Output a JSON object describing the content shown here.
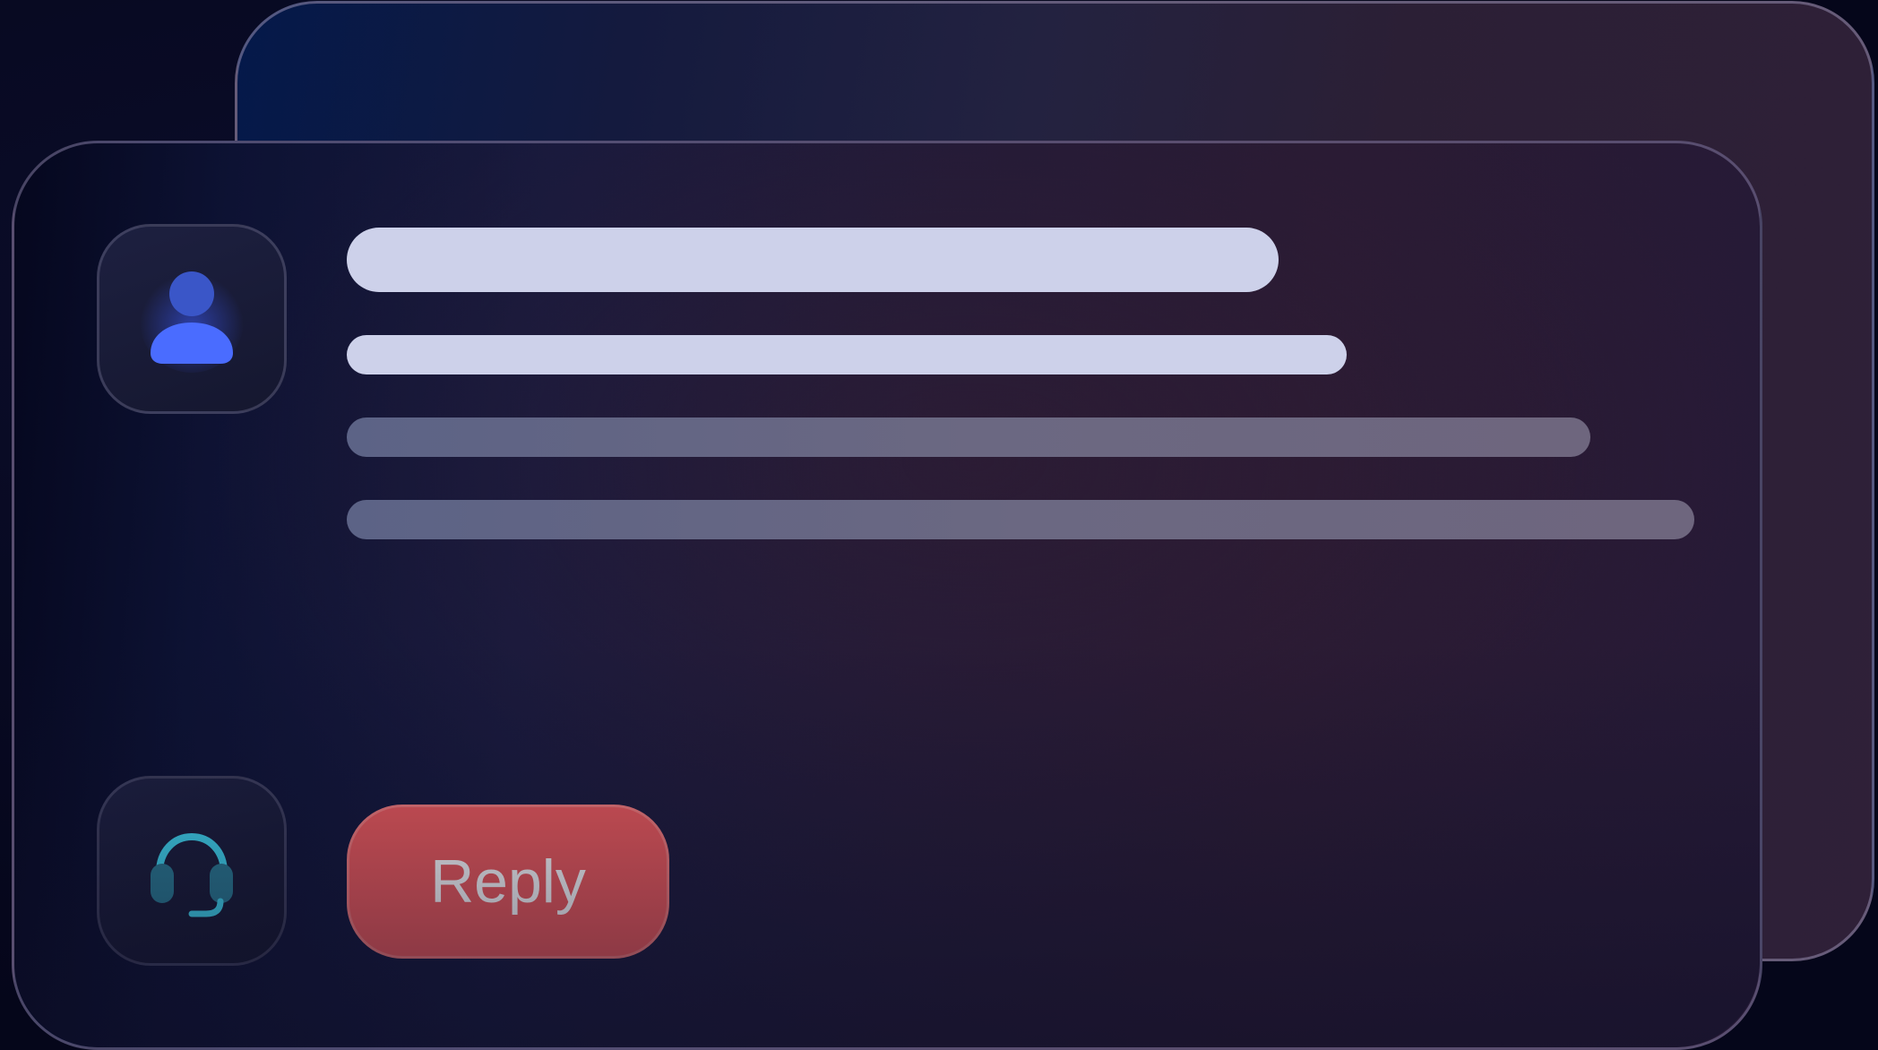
{
  "reply_button": {
    "label": "Reply"
  },
  "icons": {
    "avatar": "user-avatar-icon",
    "support": "headset-icon"
  },
  "colors": {
    "accent_button": "#ec5a5c",
    "avatar_blue": "#4a6cff",
    "headset_cyan": "#3fd6ef",
    "skeleton_light": "#cdd1ea",
    "skeleton_dim": "#646582"
  }
}
